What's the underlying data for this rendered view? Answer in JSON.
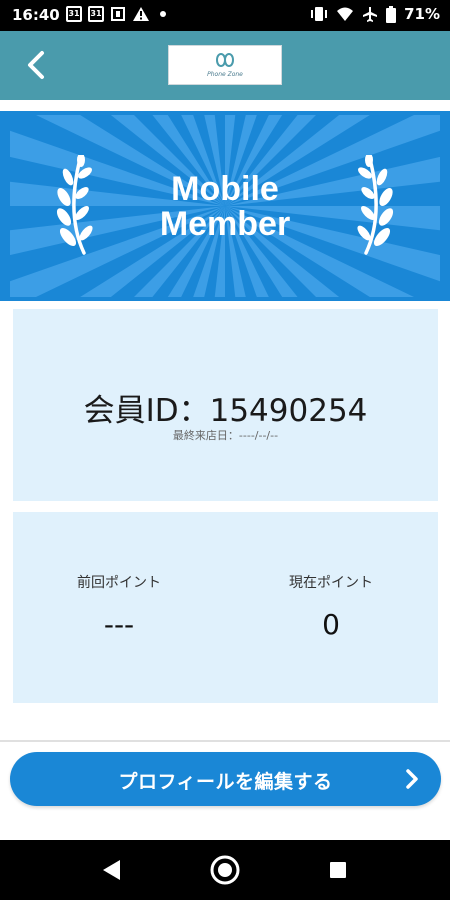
{
  "status_bar": {
    "time": "16:40",
    "calendar_day_1": "31",
    "calendar_day_2": "31",
    "battery": "71%",
    "icons": [
      "calendar-icon",
      "calendar-icon",
      "usb-icon",
      "warning-icon",
      "dot-icon",
      "vibrate-icon",
      "wifi-icon",
      "airplane-icon",
      "battery-icon"
    ]
  },
  "header": {
    "back_icon": "chevron-left-icon",
    "logo_text": "Phone Zone"
  },
  "banner": {
    "line1": "Mobile",
    "line2": "Member",
    "icons": [
      "laurel-left-icon",
      "laurel-right-icon"
    ]
  },
  "member": {
    "id_text": "会員ID：15490254",
    "last_visit": "最終来店日：----/--/--"
  },
  "points": {
    "previous_label": "前回ポイント",
    "previous_value": "---",
    "current_label": "現在ポイント",
    "current_value": "0"
  },
  "edit_button": {
    "label": "プロフィールを編集する",
    "icon": "chevron-right-icon"
  },
  "nav": {
    "icons": [
      "back-triangle-icon",
      "home-circle-icon",
      "recents-square-icon"
    ]
  },
  "colors": {
    "header": "#4a9bac",
    "banner": "#1a87d6",
    "panel": "#e0f1fc",
    "button": "#1a87d6"
  }
}
